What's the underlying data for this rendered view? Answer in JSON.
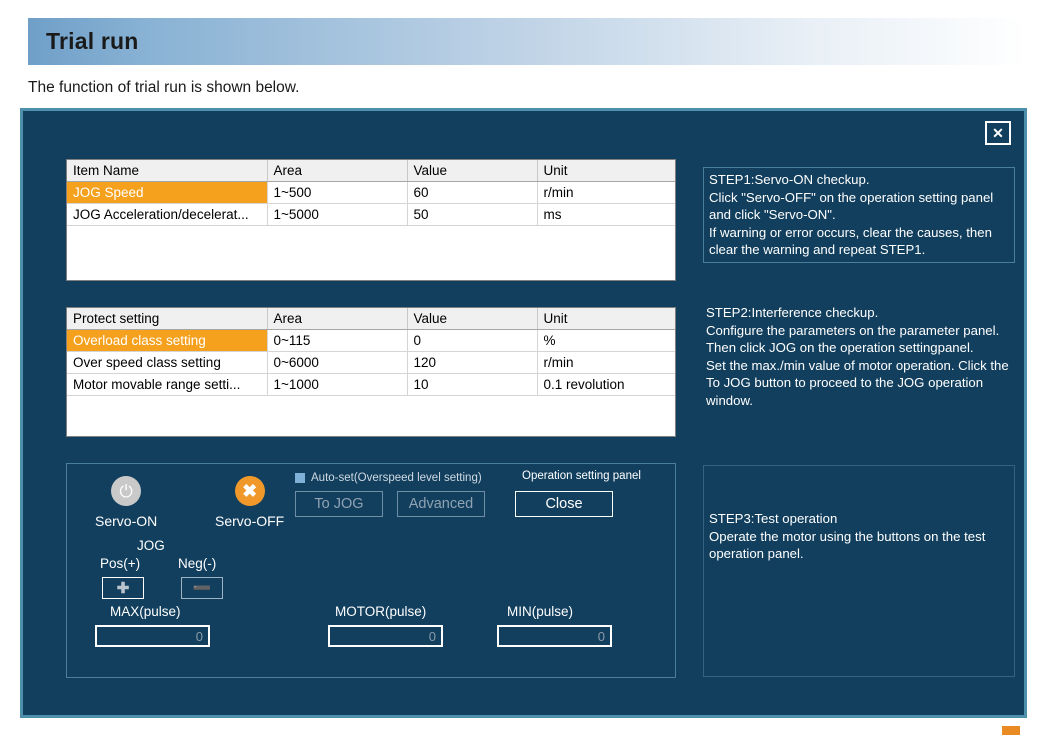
{
  "slide": {
    "title": "Trial run",
    "subtitle": "The function of trial run is shown below."
  },
  "dialog": {
    "close_icon_label": "✕"
  },
  "tables": [
    {
      "name": "jog-settings-table",
      "headers": [
        "Item Name",
        "Area",
        "Value",
        "Unit"
      ],
      "rows": [
        {
          "selected": true,
          "cells": [
            "JOG Speed",
            "1~500",
            "60",
            "r/min"
          ]
        },
        {
          "selected": false,
          "cells": [
            "JOG Acceleration/decelerat...",
            "1~5000",
            "50",
            "ms"
          ]
        }
      ]
    },
    {
      "name": "protect-settings-table",
      "headers": [
        "Protect setting",
        "Area",
        "Value",
        "Unit"
      ],
      "rows": [
        {
          "selected": true,
          "cells": [
            "Overload class setting",
            "0~115",
            "0",
            "%"
          ]
        },
        {
          "selected": false,
          "cells": [
            "Over speed class setting",
            "0~6000",
            "120",
            "r/min"
          ]
        },
        {
          "selected": false,
          "cells": [
            "Motor movable range setti...",
            "1~1000",
            "10",
            "0.1 revolution"
          ]
        }
      ]
    }
  ],
  "operation_panel": {
    "panel_title": "Operation setting panel",
    "servo_on_label": "Servo-ON",
    "servo_off_label": "Servo-OFF",
    "servo_on_icon": "power-icon",
    "servo_off_icon": "x-circle-icon",
    "autoset_checkbox_label": "Auto-set(Overspeed level setting)",
    "autoset_checked": true,
    "buttons": {
      "to_jog": "To JOG",
      "advanced": "Advanced",
      "close": "Close"
    },
    "jog": {
      "title": "JOG",
      "pos_label": "Pos(+)",
      "neg_label": "Neg(-)",
      "pos_glyph": "✚",
      "neg_glyph": "➖"
    },
    "pulses": {
      "max_label": "MAX(pulse)",
      "max_value": "0",
      "motor_label": "MOTOR(pulse)",
      "motor_value": "0",
      "min_label": "MIN(pulse)",
      "min_value": "0"
    }
  },
  "steps": {
    "step1": "STEP1:Servo-ON checkup.\nClick \"Servo-OFF\" on the operation setting panel and click \"Servo-ON\".\nIf warning or error occurs, clear the causes, then clear the warning and repeat STEP1.",
    "step2": "STEP2:Interference checkup.\nConfigure the parameters on the parameter panel. Then click JOG on the operation settingpanel.\nSet the max./min value of motor operation. Click the To JOG button to proceed to the JOG operation window.",
    "step3": "STEP3:Test operation\nOperate the motor using the buttons on the test operation panel."
  },
  "colors": {
    "dialog_bg": "#123f5e",
    "dialog_border": "#4e90ab",
    "selected_row": "#f5a11e",
    "servo_off": "#f0992a",
    "servo_on": "#c9c9c9"
  }
}
